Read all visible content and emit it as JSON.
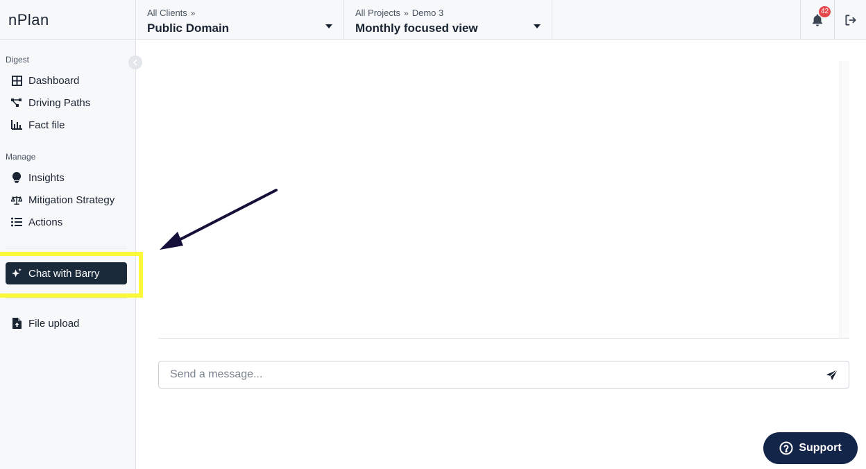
{
  "app": {
    "logo": "nPlan"
  },
  "header": {
    "client": {
      "crumb": "All Clients",
      "sep": "»",
      "value": "Public Domain"
    },
    "project": {
      "crumb": "All Projects",
      "sep": "»",
      "crumb2": "Demo 3",
      "value": "Monthly focused view"
    },
    "notifications": {
      "count": "42"
    }
  },
  "sidebar": {
    "digest_title": "Digest",
    "digest_items": [
      {
        "label": "Dashboard",
        "icon": "grid-icon"
      },
      {
        "label": "Driving Paths",
        "icon": "paths-icon"
      },
      {
        "label": "Fact file",
        "icon": "bar-chart-icon"
      }
    ],
    "manage_title": "Manage",
    "manage_items": [
      {
        "label": "Insights",
        "icon": "lightbulb-icon"
      },
      {
        "label": "Mitigation Strategy",
        "icon": "scales-icon"
      },
      {
        "label": "Actions",
        "icon": "list-icon"
      }
    ],
    "chat": {
      "label": "Chat with Barry",
      "icon": "sparkle-icon"
    },
    "upload": {
      "label": "File upload",
      "icon": "file-upload-icon"
    }
  },
  "chat": {
    "placeholder": "Send a message...",
    "value": ""
  },
  "support": {
    "label": "Support"
  },
  "colors": {
    "accent_dark": "#1a2a3a",
    "support_bg": "#14254a",
    "highlight": "#fbf83a",
    "badge": "#e5484d",
    "arrow": "#14103a"
  }
}
